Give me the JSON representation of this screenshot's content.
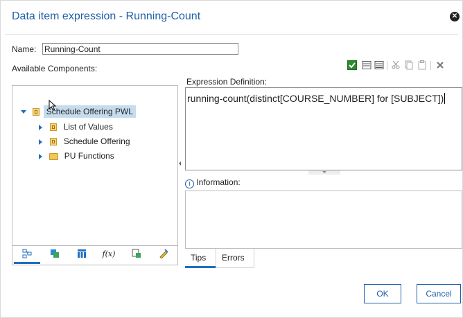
{
  "dialog": {
    "title": "Data item expression - Running-Count",
    "close_icon": "close-icon"
  },
  "name": {
    "label": "Name:",
    "value": "Running-Count"
  },
  "available_components": {
    "label": "Available Components:"
  },
  "toolbar": {
    "icons": [
      "validate-icon",
      "dimension-view-icon",
      "member-view-icon",
      "cut-icon",
      "copy-icon",
      "paste-icon",
      "delete-icon"
    ]
  },
  "tree": {
    "root": {
      "label": "Schedule Offering PWL",
      "icon": "package-icon",
      "expanded": true
    },
    "children": [
      {
        "label": "List of Values",
        "icon": "package-icon"
      },
      {
        "label": "Schedule Offering",
        "icon": "package-icon"
      },
      {
        "label": "PU Functions",
        "icon": "folder-icon"
      }
    ]
  },
  "left_tabs": {
    "icons": [
      "source-tab-icon",
      "data-items-tab-icon",
      "query-items-tab-icon",
      "functions-tab-icon",
      "parameters-tab-icon",
      "macros-tab-icon"
    ],
    "function_glyph": "f(x)"
  },
  "expression": {
    "label": "Expression Definition:",
    "text": "running-count(distinct[COURSE_NUMBER] for [SUBJECT])"
  },
  "information": {
    "label": "Information:"
  },
  "bottom_tabs": [
    {
      "label": "Tips",
      "active": true
    },
    {
      "label": "Errors",
      "active": false
    }
  ],
  "buttons": {
    "ok": "OK",
    "cancel": "Cancel"
  },
  "colors": {
    "accent": "#1f6fbf",
    "title": "#1f5fa8",
    "selection": "#c5dcee"
  }
}
